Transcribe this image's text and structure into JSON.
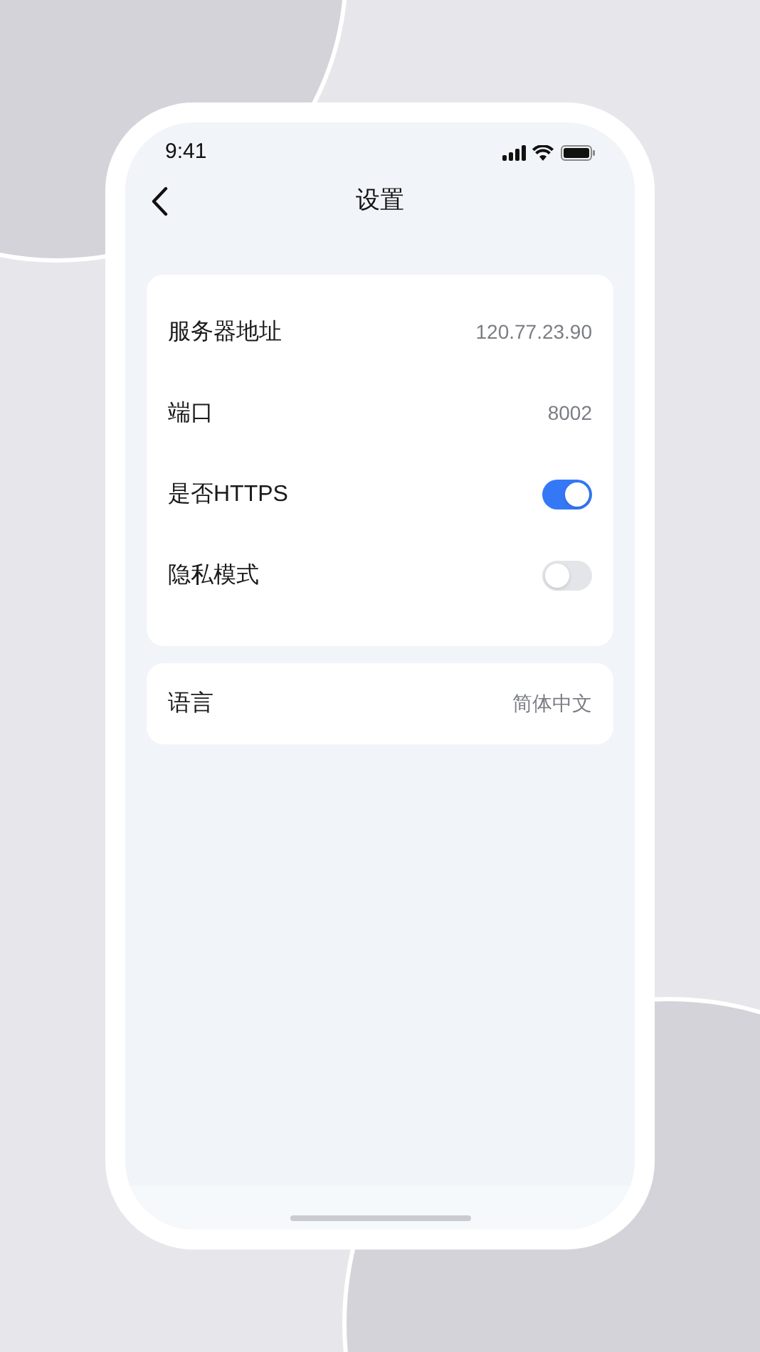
{
  "status_bar": {
    "time": "9:41"
  },
  "nav": {
    "title": "设置"
  },
  "groups": [
    {
      "items": [
        {
          "kind": "value",
          "label": "服务器地址",
          "value": "120.77.23.90"
        },
        {
          "kind": "value",
          "label": "端口",
          "value": "8002"
        },
        {
          "kind": "toggle",
          "label": "是否HTTPS",
          "on": true
        },
        {
          "kind": "toggle",
          "label": "隐私模式",
          "on": false
        }
      ]
    },
    {
      "items": [
        {
          "kind": "value",
          "label": "语言",
          "value": "简体中文"
        }
      ]
    }
  ]
}
